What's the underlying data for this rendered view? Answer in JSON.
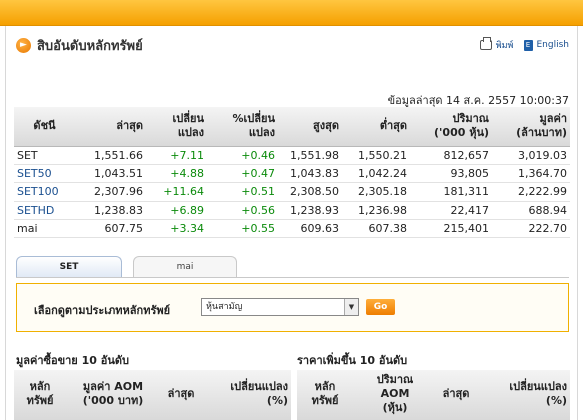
{
  "header": {
    "title": "สิบอันดับหลักทรัพย์",
    "bullet_icon": "arrow-right-icon",
    "print_label": "พิมพ์",
    "english_label": "English"
  },
  "updated": "ข้อมูลล่าสุด 14 ส.ค. 2557 10:00:37",
  "index_table": {
    "headers": [
      [
        "ดัชนี"
      ],
      [
        "ล่าสุด"
      ],
      [
        "เปลี่ยน",
        "แปลง"
      ],
      [
        "%เปลี่ยน",
        "แปลง"
      ],
      [
        "สูงสุด"
      ],
      [
        "ต่ำสุด"
      ],
      [
        "ปริมาณ",
        "('000 หุ้น)"
      ],
      [
        "มูลค่า",
        "(ล้านบาท)"
      ]
    ],
    "rows": [
      {
        "name": "SET",
        "last": "1,551.66",
        "change": "+7.11",
        "pct": "+0.46",
        "high": "1,551.98",
        "low": "1,550.21",
        "volume": "812,657",
        "value": "3,019.03"
      },
      {
        "name": "SET50",
        "last": "1,043.51",
        "change": "+4.88",
        "pct": "+0.47",
        "high": "1,043.83",
        "low": "1,042.24",
        "volume": "93,805",
        "value": "1,364.70"
      },
      {
        "name": "SET100",
        "last": "2,307.96",
        "change": "+11.64",
        "pct": "+0.51",
        "high": "2,308.50",
        "low": "2,305.18",
        "volume": "181,311",
        "value": "2,222.99"
      },
      {
        "name": "SETHD",
        "last": "1,238.83",
        "change": "+6.89",
        "pct": "+0.56",
        "high": "1,238.93",
        "low": "1,236.98",
        "volume": "22,417",
        "value": "688.94"
      },
      {
        "name": "mai",
        "last": "607.75",
        "change": "+3.34",
        "pct": "+0.55",
        "high": "609.63",
        "low": "607.38",
        "volume": "215,401",
        "value": "222.70"
      }
    ]
  },
  "tabs": [
    {
      "label": "SET",
      "active": true
    },
    {
      "label": "mai",
      "active": false
    }
  ],
  "filter": {
    "label": "เลือกดูตามประเภทหลักทรัพย์",
    "selected": "หุ้นสามัญ",
    "go_label": "Go"
  },
  "top_value": {
    "title": "มูลค่าซื้อขาย 10 อันดับ",
    "col_security": [
      "หลัก",
      "ทรัพย์"
    ],
    "col_aom": [
      "มูลค่า AOM",
      "('000 บาท)"
    ],
    "col_last": "ล่าสุด",
    "col_change": [
      "เปลี่ยนแปลง",
      "(%)"
    ]
  },
  "top_gainers": {
    "title": "ราคาเพิ่มขึ้น 10 อันดับ",
    "col_security": [
      "หลัก",
      "ทรัพย์"
    ],
    "col_aom": [
      "ปริมาณ",
      "AOM",
      "(หุ้น)"
    ],
    "col_last": "ล่าสุด",
    "col_change": [
      "เปลี่ยนแปลง",
      "(%)"
    ]
  },
  "colors": {
    "top_bar": "#f5a000",
    "positive": "#0a8a0a",
    "link": "#1a4f8f"
  }
}
